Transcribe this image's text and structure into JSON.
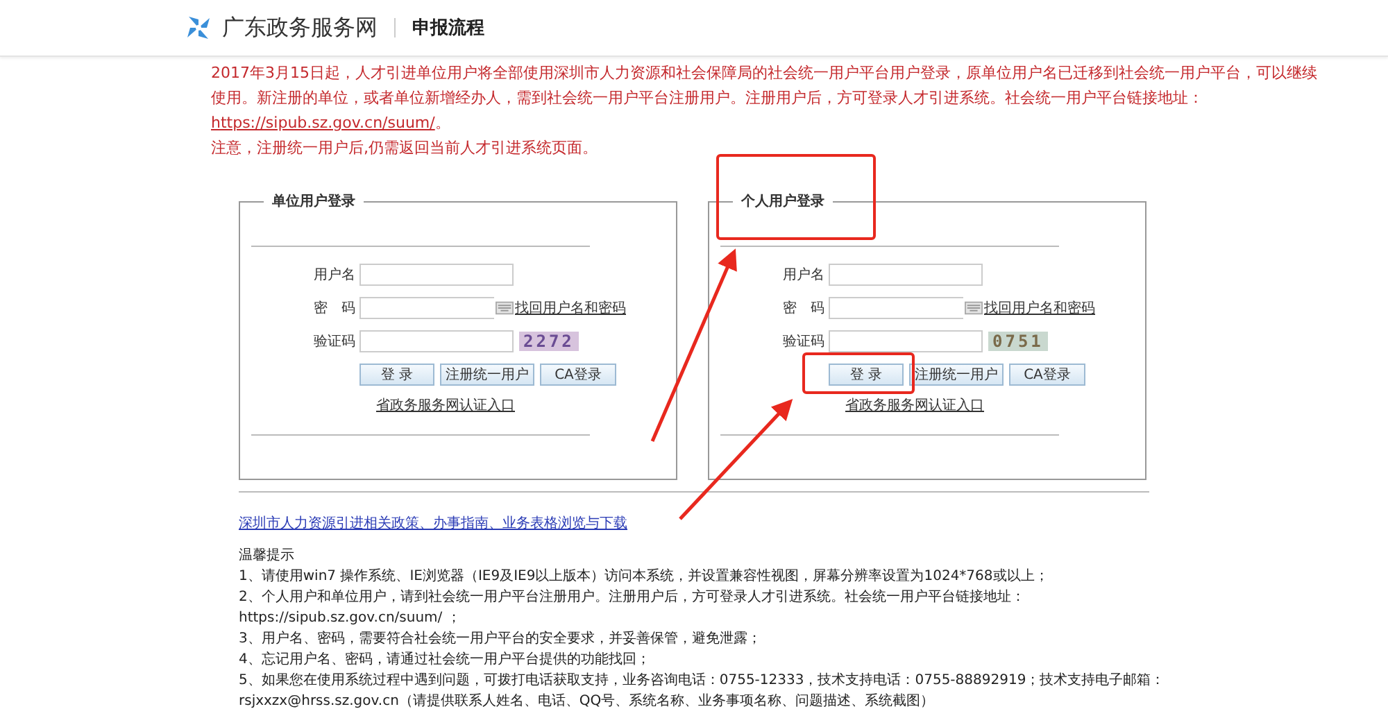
{
  "header": {
    "site_name": "广东政务服务网",
    "page_title": "申报流程"
  },
  "notice": {
    "text": "2017年3月15日起，人才引进单位用户将全部使用深圳市人力资源和社会保障局的社会统一用户平台用户登录，原单位用户名已迁移到社会统一用户平台，可以继续使用。新注册的单位，或者单位新增经办人，需到社会统一用户平台注册用户。注册用户后，方可登录人才引进系统。社会统一用户平台链接地址：",
    "link": "https://sipub.sz.gov.cn/suum/",
    "after_link": "。",
    "note": "注意，注册统一用户后,仍需返回当前人才引进系统页面。"
  },
  "login_panels": [
    {
      "title": "单位用户登录",
      "fields": [
        {
          "label": "用户名",
          "kind": "text"
        },
        {
          "label": "密　码",
          "kind": "password"
        },
        {
          "label": "验证码",
          "kind": "captcha"
        }
      ],
      "recover_link": "找回用户名和密码",
      "captcha": "2272",
      "buttons": [
        "登 录",
        "注册统一用户",
        "CA登录"
      ],
      "portal_link": "省政务服务网认证入口"
    },
    {
      "title": "个人用户登录",
      "fields": [
        {
          "label": "用户名",
          "kind": "text"
        },
        {
          "label": "密　码",
          "kind": "password"
        },
        {
          "label": "验证码",
          "kind": "captcha"
        }
      ],
      "recover_link": "找回用户名和密码",
      "captcha": "0751",
      "buttons": [
        "登 录",
        "注册统一用户",
        "CA登录"
      ],
      "portal_link": "省政务服务网认证入口"
    }
  ],
  "resources_link": "深圳市人力资源引进相关政策、办事指南、业务表格浏览与下载",
  "tips": {
    "title": "温馨提示",
    "lines": [
      "1、请使用win7 操作系统、IE浏览器（IE9及IE9以上版本）访问本系统，并设置兼容性视图，屏幕分辨率设置为1024*768或以上；",
      "2、个人用户和单位用户，请到社会统一用户平台注册用户。注册用户后，方可登录人才引进系统。社会统一用户平台链接地址：",
      "https://sipub.sz.gov.cn/suum/ ；",
      "3、用户名、密码，需要符合社会统一用户平台的安全要求，并妥善保管，避免泄露；",
      "4、忘记用户名、密码，请通过社会统一用户平台提供的功能找回；",
      "5、如果您在使用系统过程中遇到问题，可拨打电话获取支持，业务咨询电话：0755-12333，技术支持电话：0755-88892919；技术支持电子邮箱：",
      "rsjxxzx@hrss.sz.gov.cn（请提供联系人姓名、电话、QQ号、系统名称、业务事项名称、问题描述、系统截图）"
    ]
  }
}
